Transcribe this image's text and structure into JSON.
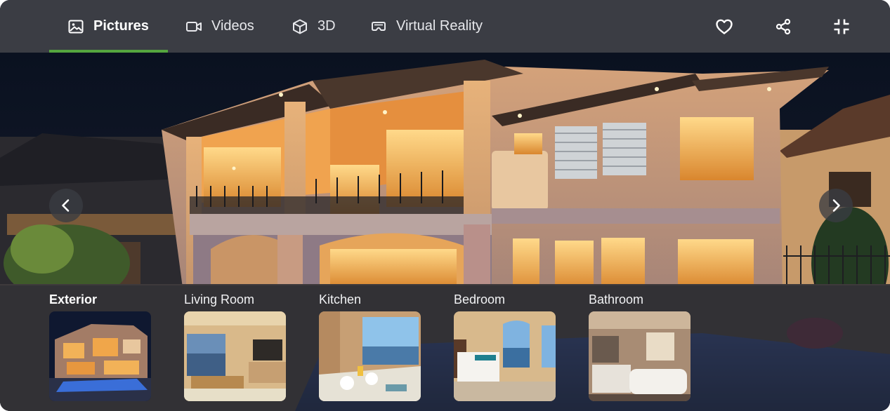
{
  "tabs": [
    {
      "label": "Pictures",
      "icon": "image-icon",
      "active": true
    },
    {
      "label": "Videos",
      "icon": "video-camera-icon",
      "active": false
    },
    {
      "label": "3D",
      "icon": "cube-icon",
      "active": false
    },
    {
      "label": "Virtual Reality",
      "icon": "vr-headset-icon",
      "active": false
    }
  ],
  "actions": {
    "favorite": "heart-icon",
    "share": "share-icon",
    "collapse": "collapse-icon"
  },
  "navigation": {
    "prev": "chevron-left-icon",
    "next": "chevron-right-icon"
  },
  "gallery": {
    "items": [
      {
        "label": "Exterior",
        "active": true
      },
      {
        "label": "Living Room",
        "active": false
      },
      {
        "label": "Kitchen",
        "active": false
      },
      {
        "label": "Bedroom",
        "active": false
      },
      {
        "label": "Bathroom",
        "active": false
      }
    ]
  },
  "colors": {
    "topbar": "#3b3d44",
    "accent": "#55a63f",
    "night_sky": "#0d1424",
    "warm_light": "#f3b15a"
  }
}
